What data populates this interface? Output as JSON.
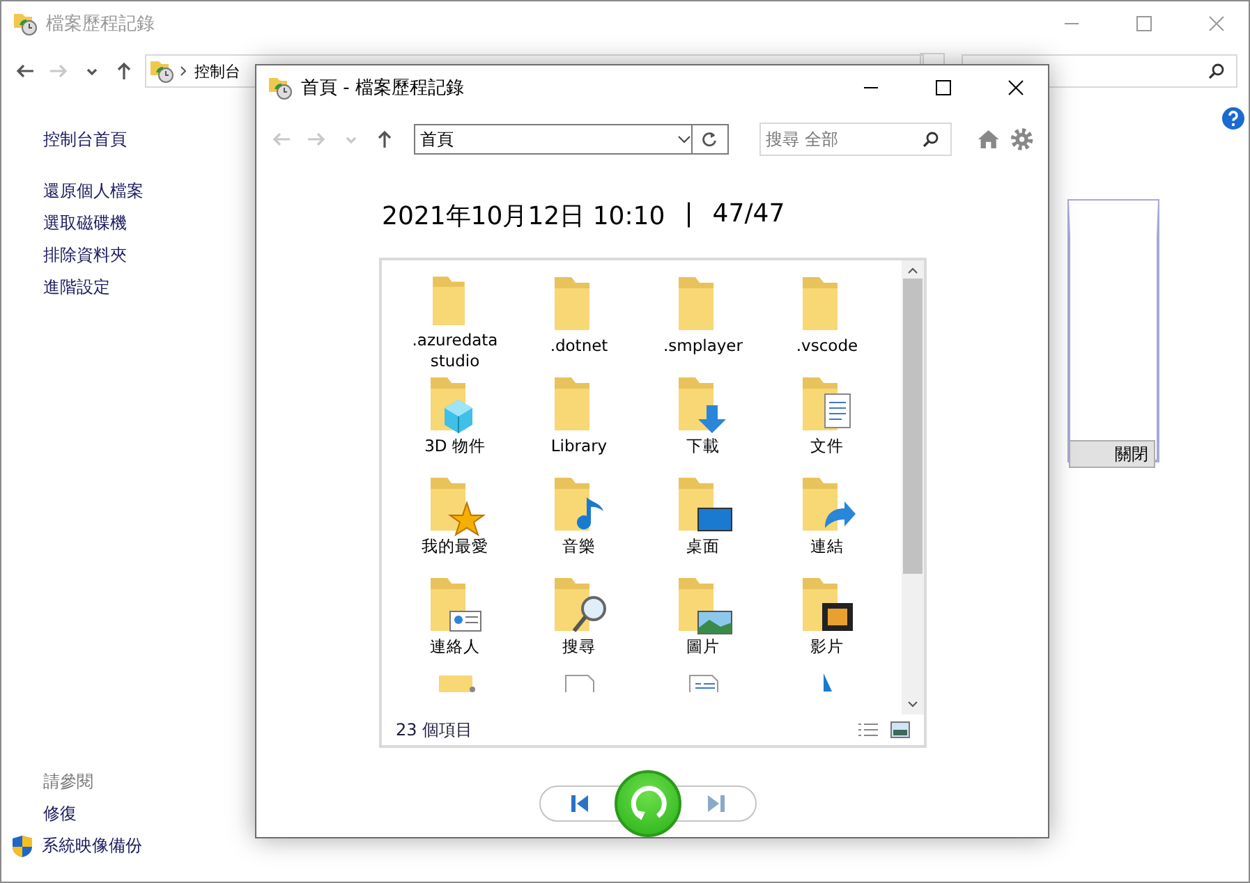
{
  "back_window": {
    "title": "檔案歷程記錄",
    "breadcrumb": [
      "控制台"
    ],
    "sidebar": {
      "home": "控制台首頁",
      "links": [
        "還原個人檔案",
        "選取磁碟機",
        "排除資料夾",
        "進階設定"
      ],
      "see_also_heading": "請參閱",
      "see_also": [
        {
          "label": "修復",
          "kind": "plain"
        },
        {
          "label": "系統映像備份",
          "kind": "shield"
        }
      ]
    },
    "close_button": "關閉"
  },
  "dialog": {
    "title": "首頁 - 檔案歷程記錄",
    "address": "首頁",
    "search": {
      "placeholder": "搜尋 全部"
    },
    "timestamp": "2021年10月12日 10:10",
    "separator": "|",
    "position": "47/47",
    "items": [
      {
        "label": ".azuredata studio",
        "kind": "folder"
      },
      {
        "label": ".dotnet",
        "kind": "folder"
      },
      {
        "label": ".smplayer",
        "kind": "folder"
      },
      {
        "label": ".vscode",
        "kind": "folder"
      },
      {
        "label": "3D 物件",
        "kind": "cube"
      },
      {
        "label": "Library",
        "kind": "folder"
      },
      {
        "label": "下載",
        "kind": "download"
      },
      {
        "label": "文件",
        "kind": "document"
      },
      {
        "label": "我的最愛",
        "kind": "star"
      },
      {
        "label": "音樂",
        "kind": "music"
      },
      {
        "label": "桌面",
        "kind": "desktop"
      },
      {
        "label": "連結",
        "kind": "link"
      },
      {
        "label": "連絡人",
        "kind": "contact"
      },
      {
        "label": "搜尋",
        "kind": "search"
      },
      {
        "label": "圖片",
        "kind": "picture"
      },
      {
        "label": "影片",
        "kind": "video"
      }
    ],
    "partial_items": [
      {
        "kind": "user"
      },
      {
        "kind": "blank"
      },
      {
        "kind": "doc"
      },
      {
        "kind": "pointer"
      }
    ],
    "status": "23 個項目",
    "previous": {
      "disabled": false
    },
    "next": {
      "disabled": true
    }
  }
}
